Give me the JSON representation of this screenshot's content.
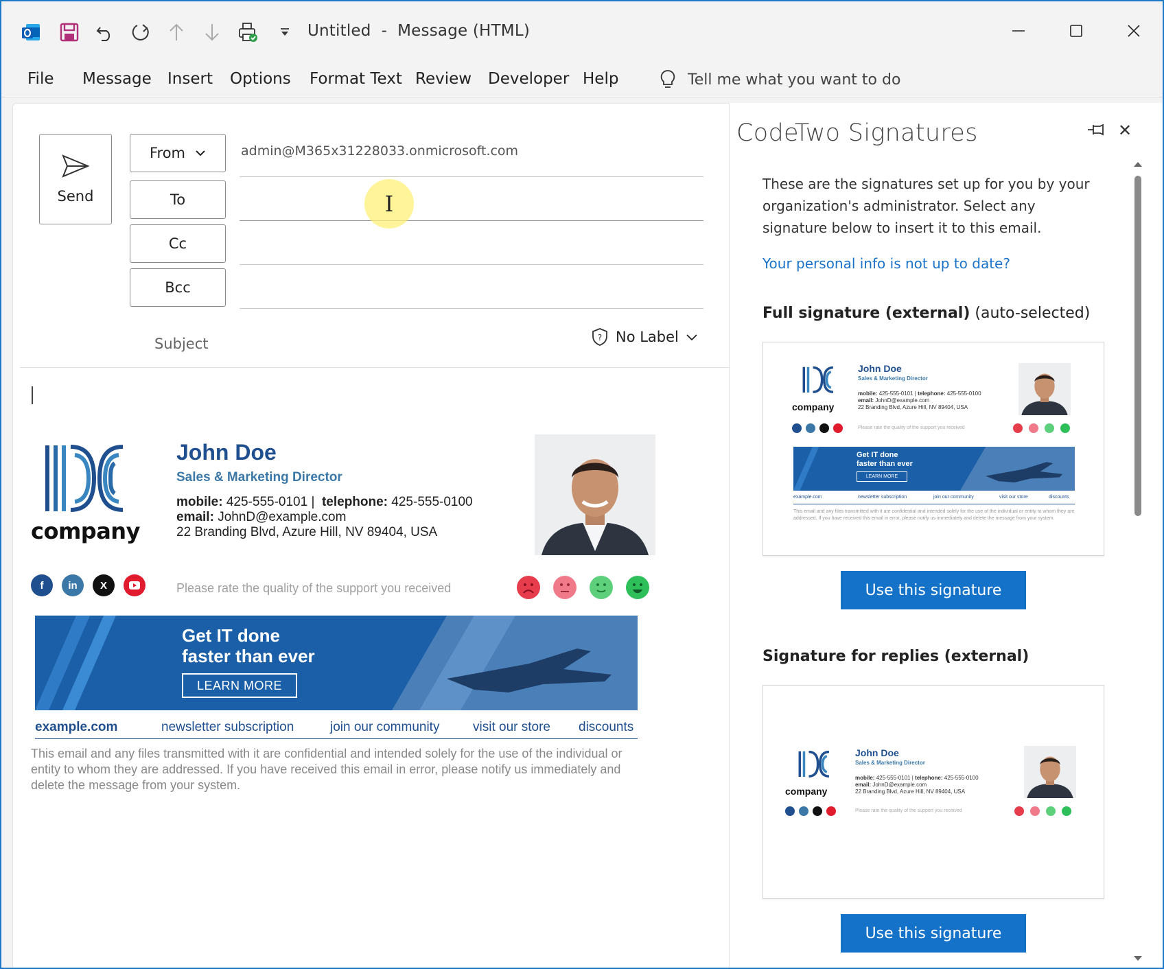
{
  "window": {
    "title_doc": "Untitled",
    "title_sep": "-",
    "title_type": "Message (HTML)"
  },
  "menu": {
    "items": [
      "File",
      "Message",
      "Insert",
      "Options",
      "Format Text",
      "Review",
      "Developer",
      "Help"
    ],
    "tell_me": "Tell me what you want to do"
  },
  "compose": {
    "send_label": "Send",
    "from_label": "From",
    "from_value": "admin@M365x31228033.onmicrosoft.com",
    "to_label": "To",
    "cc_label": "Cc",
    "bcc_label": "Bcc",
    "subject_label": "Subject",
    "sensitivity_label": "No Label",
    "cursor_glyph": "I"
  },
  "signature": {
    "logo_text": "company",
    "name": "John Doe",
    "title": "Sales & Marketing Director",
    "mobile_label": "mobile:",
    "mobile": "425-555-0101",
    "sep": "|",
    "telephone_label": "telephone:",
    "telephone": "425-555-0100",
    "email_label": "email:",
    "email": "JohnD@example.com",
    "address": "22 Branding Blvd, Azure Hill, NV 89404, USA",
    "social_icons": [
      "facebook-icon",
      "linkedin-icon",
      "x-icon",
      "youtube-icon"
    ],
    "rate_text": "Please rate the quality of the support you received",
    "banner_line1": "Get IT done",
    "banner_line2": "faster than ever",
    "banner_button": "LEARN MORE",
    "links": [
      "example.com",
      "newsletter subscription",
      "join our community",
      "visit our store",
      "discounts"
    ],
    "disclaimer": "This email and any files transmitted with it are confidential and intended solely for the use of the individual or entity to whom they are addressed. If you have received this email in error, please notify us immediately and delete the message from your system.",
    "colors": {
      "brand": "#1f4f8f",
      "accent": "#3b78a8",
      "banner": "#1a5fa8"
    }
  },
  "pane": {
    "title": "CodeTwo Signatures",
    "intro": "These are the signatures set up for you by your organization's administrator. Select any signature below to insert it to this email.",
    "link": "Your personal info is not up to date?",
    "section1_bold": "Full signature (external)",
    "section1_note": "(auto-selected)",
    "section2_bold": "Signature for replies (external)",
    "use_button": "Use this signature",
    "accent_color": "#1473c9"
  }
}
